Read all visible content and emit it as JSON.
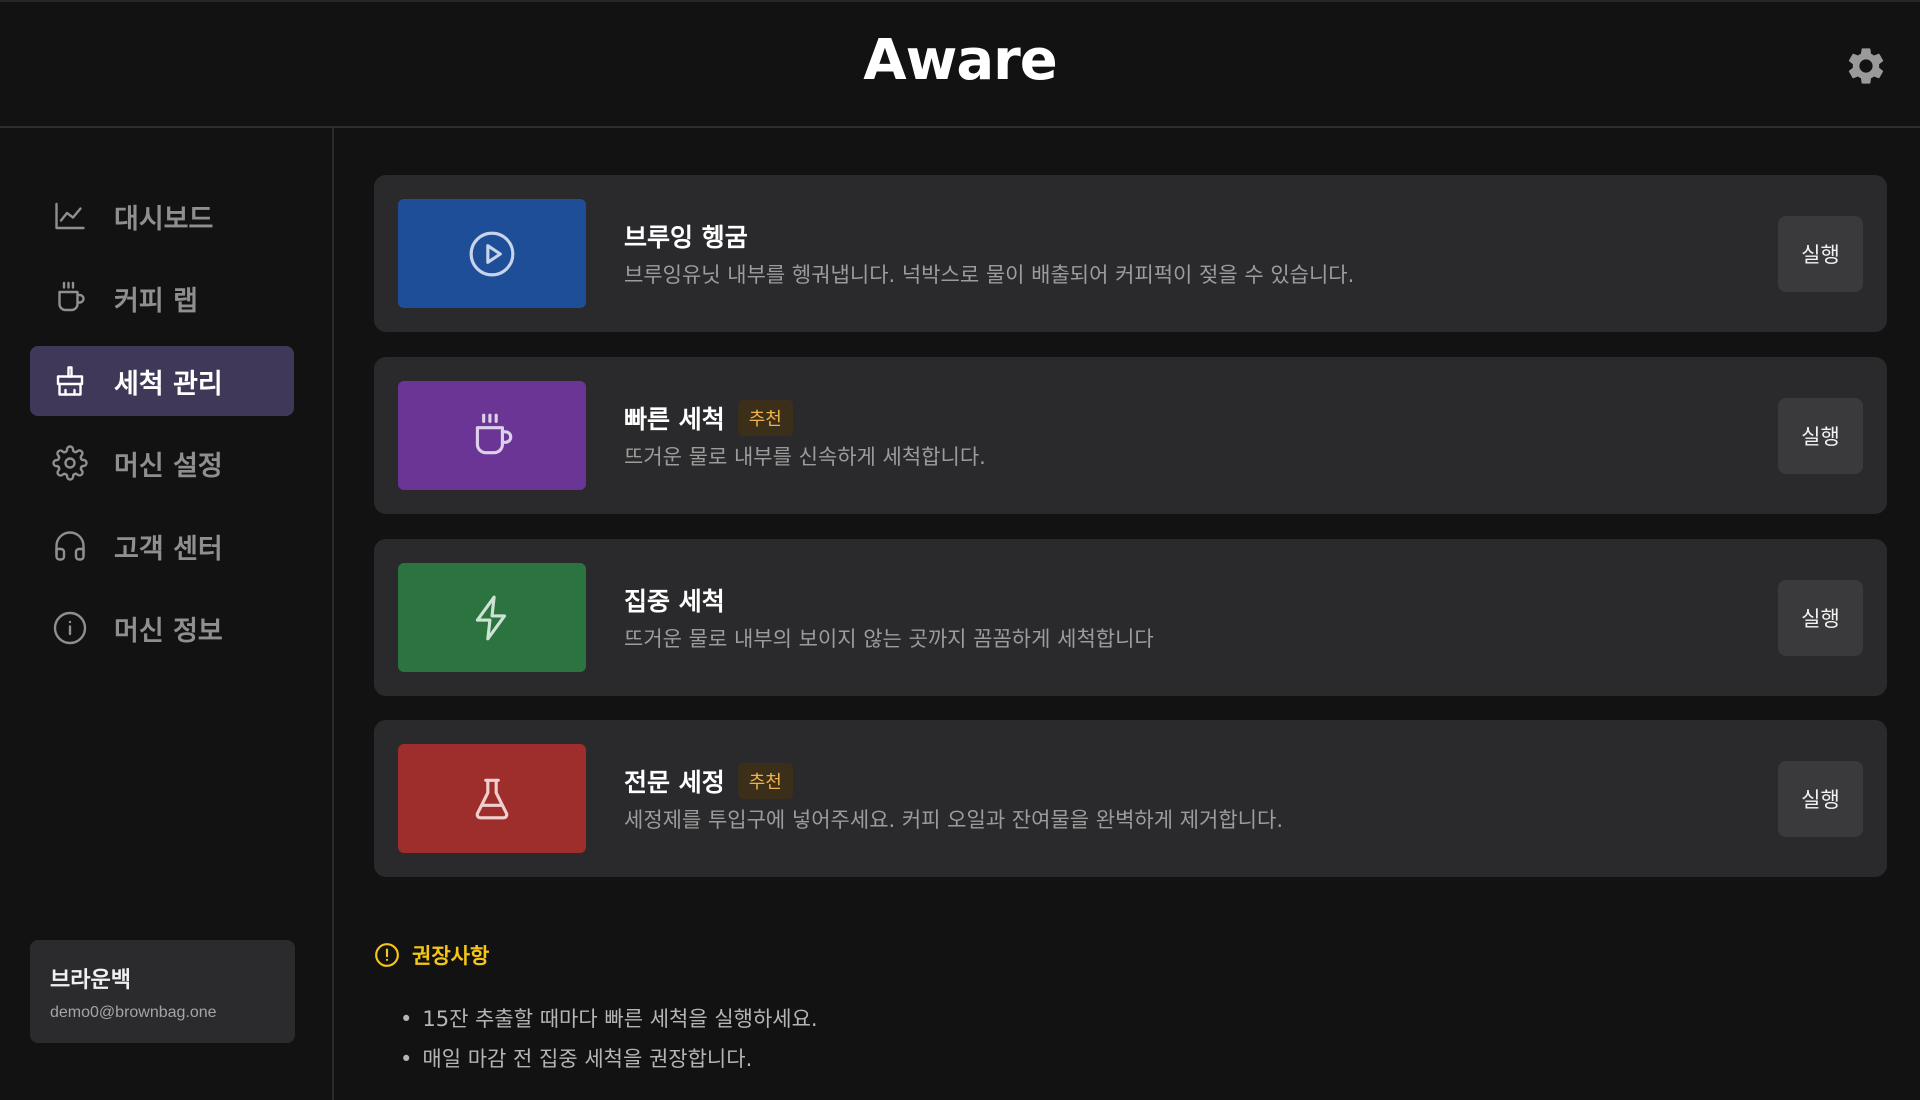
{
  "header": {
    "title": "Aware",
    "settings_icon": "gear-icon"
  },
  "sidebar": {
    "items": [
      {
        "label": "대시보드",
        "icon": "chart-icon",
        "active": false
      },
      {
        "label": "커피 랩",
        "icon": "coffee-cup-icon",
        "active": false
      },
      {
        "label": "세척 관리",
        "icon": "broom-icon",
        "active": true
      },
      {
        "label": "머신 설정",
        "icon": "gear-icon",
        "active": false
      },
      {
        "label": "고객 센터",
        "icon": "headphones-icon",
        "active": false
      },
      {
        "label": "머신 정보",
        "icon": "info-icon",
        "active": false
      }
    ],
    "user": {
      "name": "브라운백",
      "email": "demo0@brownbag.one"
    }
  },
  "cleaning": {
    "cards": [
      {
        "title": "브루잉 헹굼",
        "badge": "",
        "description": "브루잉유닛 내부를 헹궈냅니다. 넉박스로 물이 배출되어 커피퍽이 젖을 수 있습니다.",
        "icon": "play-icon",
        "color": "#1f4e99",
        "button": "실행"
      },
      {
        "title": "빠른 세척",
        "badge": "추천",
        "description": "뜨거운 물로 내부를 신속하게 세척합니다.",
        "icon": "coffee-cup-icon",
        "color": "#6b3596",
        "button": "실행"
      },
      {
        "title": "집중 세척",
        "badge": "",
        "description": "뜨거운 물로 내부의 보이지 않는 곳까지 꼼꼼하게 세척합니다",
        "icon": "lightning-icon",
        "color": "#2b7440",
        "button": "실행"
      },
      {
        "title": "전문 세정",
        "badge": "추천",
        "description": "세정제를 투입구에 넣어주세요. 커피 오일과 잔여물을 완벽하게 제거합니다.",
        "icon": "flask-icon",
        "color": "#9e2e2b",
        "button": "실행"
      }
    ]
  },
  "recommendations": {
    "title": "권장사항",
    "items": [
      "15잔 추출할 때마다 빠른 세척을 실행하세요.",
      "매일 마감 전 집중 세척을 권장합니다."
    ]
  }
}
